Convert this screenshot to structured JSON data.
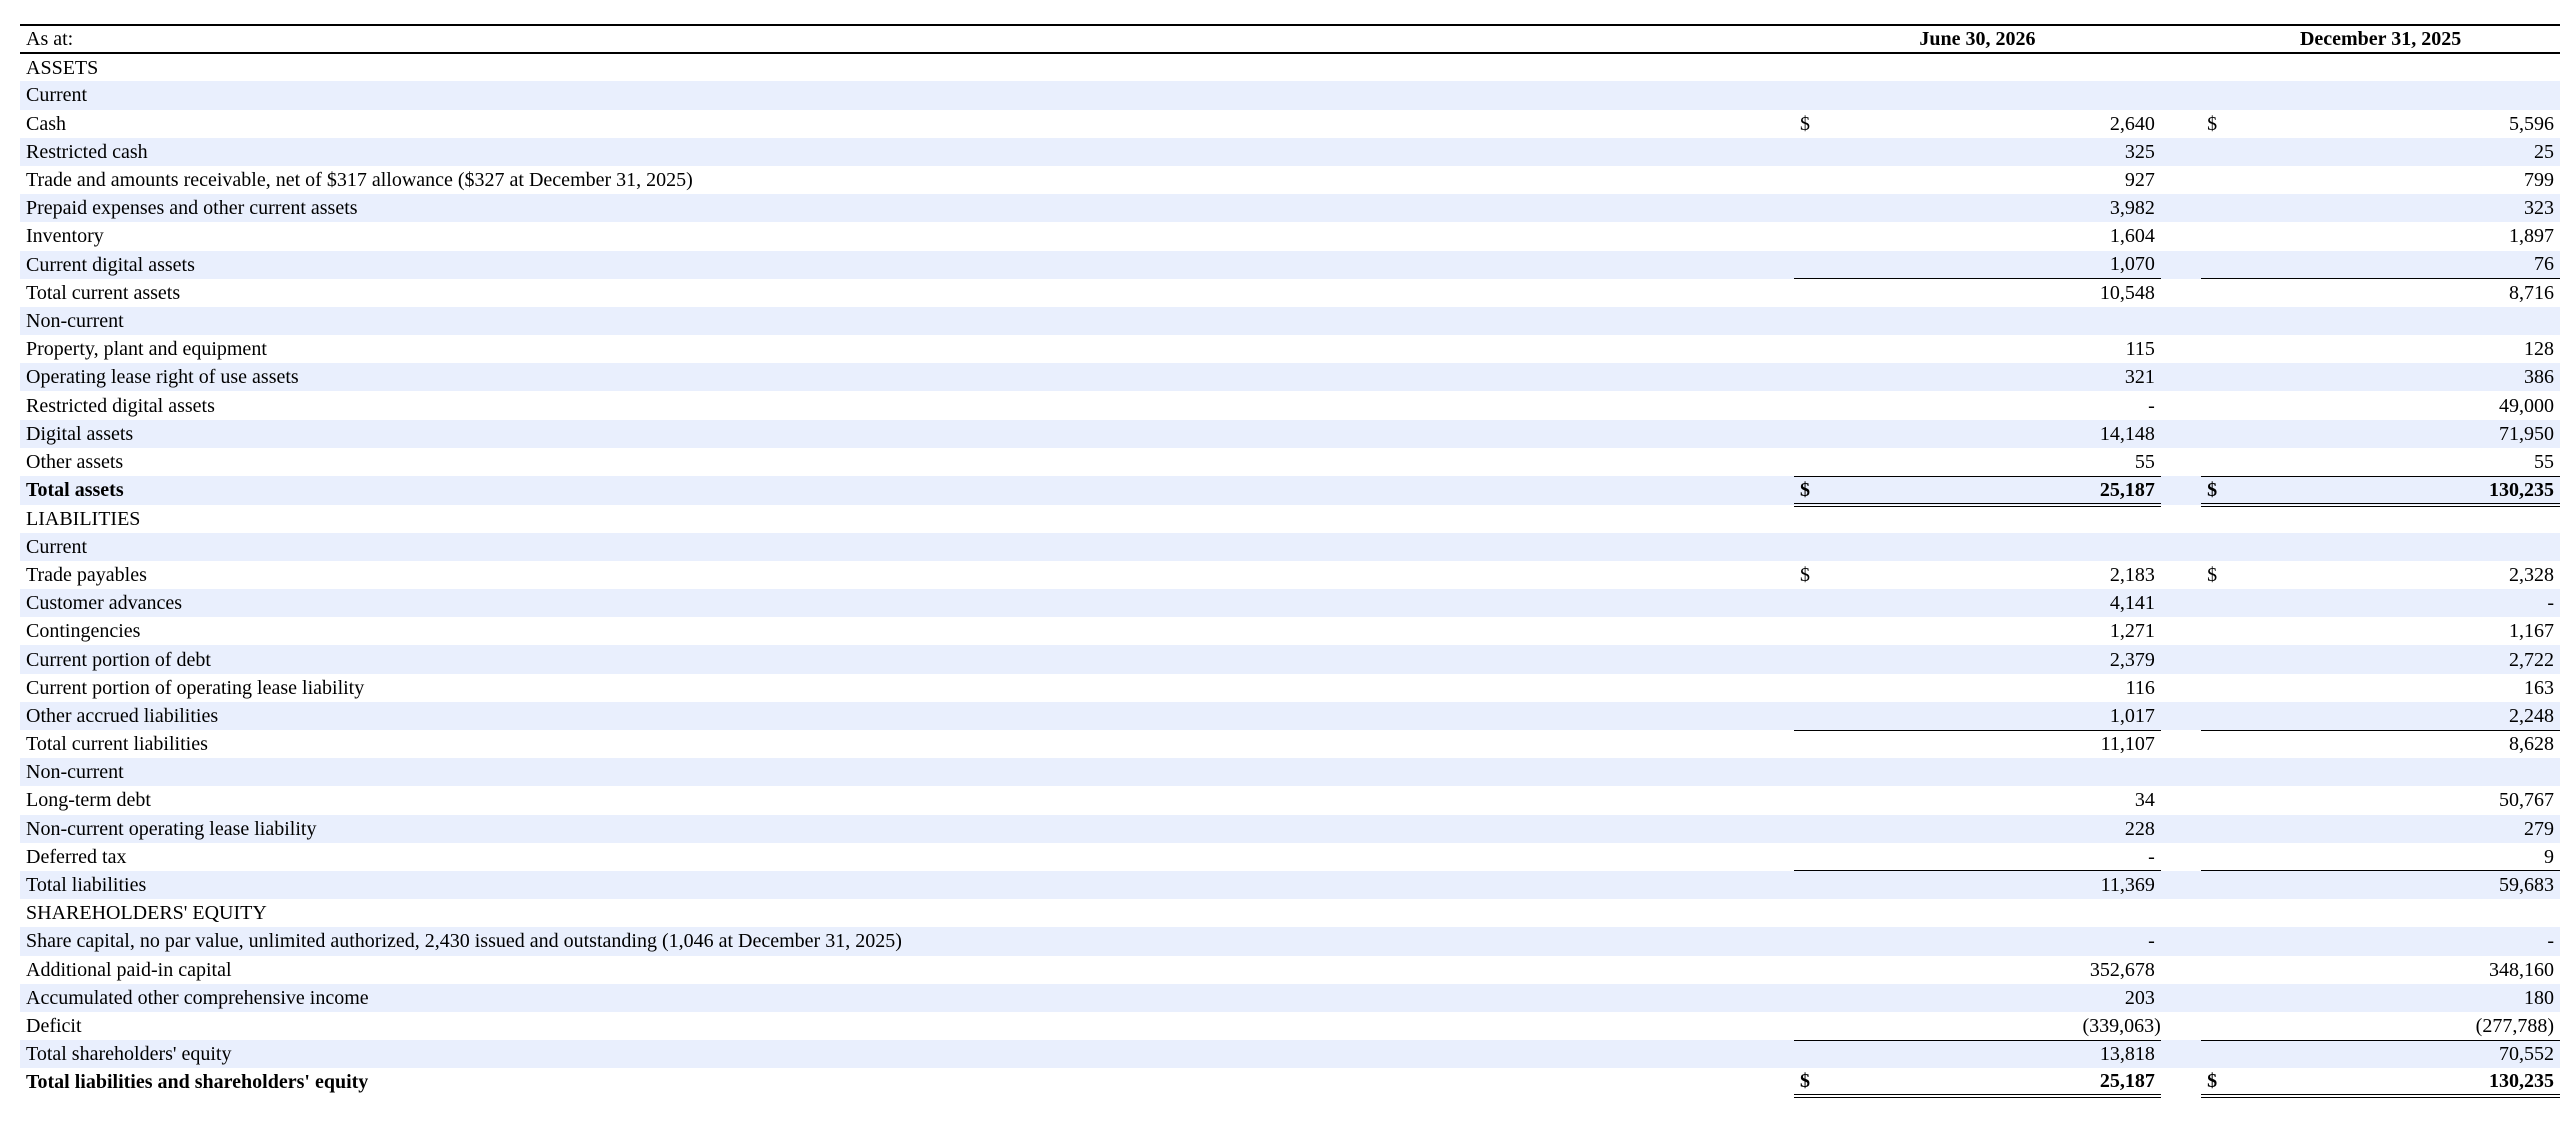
{
  "header": {
    "as_at": "As at:",
    "col1": "June 30, 2026",
    "col2": "December 31, 2025"
  },
  "currency_symbol": "$",
  "rows": [
    {
      "label": "ASSETS",
      "indent": false,
      "shaded": false
    },
    {
      "label": "Current",
      "indent": false,
      "shaded": true
    },
    {
      "label": "Cash",
      "indent": true,
      "shaded": false,
      "cur": true,
      "v1": "2,640",
      "v2": "5,596"
    },
    {
      "label": "Restricted cash",
      "indent": true,
      "shaded": true,
      "v1": "325",
      "v2": "25"
    },
    {
      "label": "Trade and amounts receivable, net of $317 allowance ($327 at December 31, 2025)",
      "indent": true,
      "shaded": false,
      "v1": "927",
      "v2": "799"
    },
    {
      "label": "Prepaid expenses and other current assets",
      "indent": true,
      "shaded": true,
      "v1": "3,982",
      "v2": "323"
    },
    {
      "label": "Inventory",
      "indent": true,
      "shaded": false,
      "v1": "1,604",
      "v2": "1,897"
    },
    {
      "label": "Current digital assets",
      "indent": true,
      "shaded": true,
      "v1": "1,070",
      "v2": "76"
    },
    {
      "label": "Total current assets",
      "indent": false,
      "shaded": false,
      "v1": "10,548",
      "v2": "8,716",
      "top_rule": true
    },
    {
      "label": "Non-current",
      "indent": false,
      "shaded": true
    },
    {
      "label": "Property, plant and equipment",
      "indent": true,
      "shaded": false,
      "v1": "115",
      "v2": "128"
    },
    {
      "label": "Operating lease right of use assets",
      "indent": true,
      "shaded": true,
      "v1": "321",
      "v2": "386"
    },
    {
      "label": "Restricted digital assets",
      "indent": true,
      "shaded": false,
      "v1": "-",
      "v2": "49,000"
    },
    {
      "label": "Digital assets",
      "indent": true,
      "shaded": true,
      "v1": "14,148",
      "v2": "71,950"
    },
    {
      "label": "Other assets",
      "indent": true,
      "shaded": false,
      "v1": "55",
      "v2": "55"
    },
    {
      "label": "Total assets",
      "indent": false,
      "shaded": true,
      "cur": true,
      "bold": true,
      "v1": "25,187",
      "v2": "130,235",
      "top_rule": true,
      "double_bottom": true
    },
    {
      "label": "LIABILITIES",
      "indent": false,
      "shaded": false
    },
    {
      "label": "Current",
      "indent": false,
      "shaded": true
    },
    {
      "label": "Trade payables",
      "indent": true,
      "shaded": false,
      "cur": true,
      "v1": "2,183",
      "v2": "2,328"
    },
    {
      "label": "Customer advances",
      "indent": true,
      "shaded": true,
      "v1": "4,141",
      "v2": "-"
    },
    {
      "label": "Contingencies",
      "indent": true,
      "shaded": false,
      "v1": "1,271",
      "v2": "1,167"
    },
    {
      "label": "Current portion of debt",
      "indent": true,
      "shaded": true,
      "v1": "2,379",
      "v2": "2,722"
    },
    {
      "label": "Current portion of operating lease liability",
      "indent": true,
      "shaded": false,
      "v1": "116",
      "v2": "163"
    },
    {
      "label": "Other accrued liabilities",
      "indent": true,
      "shaded": true,
      "v1": "1,017",
      "v2": "2,248"
    },
    {
      "label": "Total current liabilities",
      "indent": false,
      "shaded": false,
      "v1": "11,107",
      "v2": "8,628",
      "top_rule": true
    },
    {
      "label": "Non-current",
      "indent": false,
      "shaded": true
    },
    {
      "label": "Long-term debt",
      "indent": true,
      "shaded": false,
      "v1": "34",
      "v2": "50,767"
    },
    {
      "label": "Non-current operating lease liability",
      "indent": true,
      "shaded": true,
      "v1": "228",
      "v2": "279"
    },
    {
      "label": "Deferred tax",
      "indent": true,
      "shaded": false,
      "v1": "-",
      "v2": "9"
    },
    {
      "label": "Total liabilities",
      "indent": false,
      "shaded": true,
      "v1": "11,369",
      "v2": "59,683",
      "top_rule": true
    },
    {
      "label": "SHAREHOLDERS' EQUITY",
      "indent": false,
      "shaded": false
    },
    {
      "label": "Share capital, no par value, unlimited authorized, 2,430 issued and outstanding (1,046 at December 31, 2025)",
      "indent": true,
      "shaded": true,
      "v1": "-",
      "v2": "-"
    },
    {
      "label": "Additional paid-in capital",
      "indent": true,
      "shaded": false,
      "v1": "352,678",
      "v2": "348,160"
    },
    {
      "label": "Accumulated other comprehensive income",
      "indent": true,
      "shaded": true,
      "v1": "203",
      "v2": "180"
    },
    {
      "label": "Deficit",
      "indent": true,
      "shaded": false,
      "v1": "(339,063)",
      "v2": "(277,788)",
      "paren": true
    },
    {
      "label": "Total shareholders' equity",
      "indent": false,
      "shaded": true,
      "v1": "13,818",
      "v2": "70,552",
      "top_rule": true
    },
    {
      "label": "Total liabilities and shareholders' equity",
      "indent": false,
      "shaded": false,
      "cur": true,
      "bold": true,
      "v1": "25,187",
      "v2": "130,235",
      "double_bottom": true
    }
  ]
}
